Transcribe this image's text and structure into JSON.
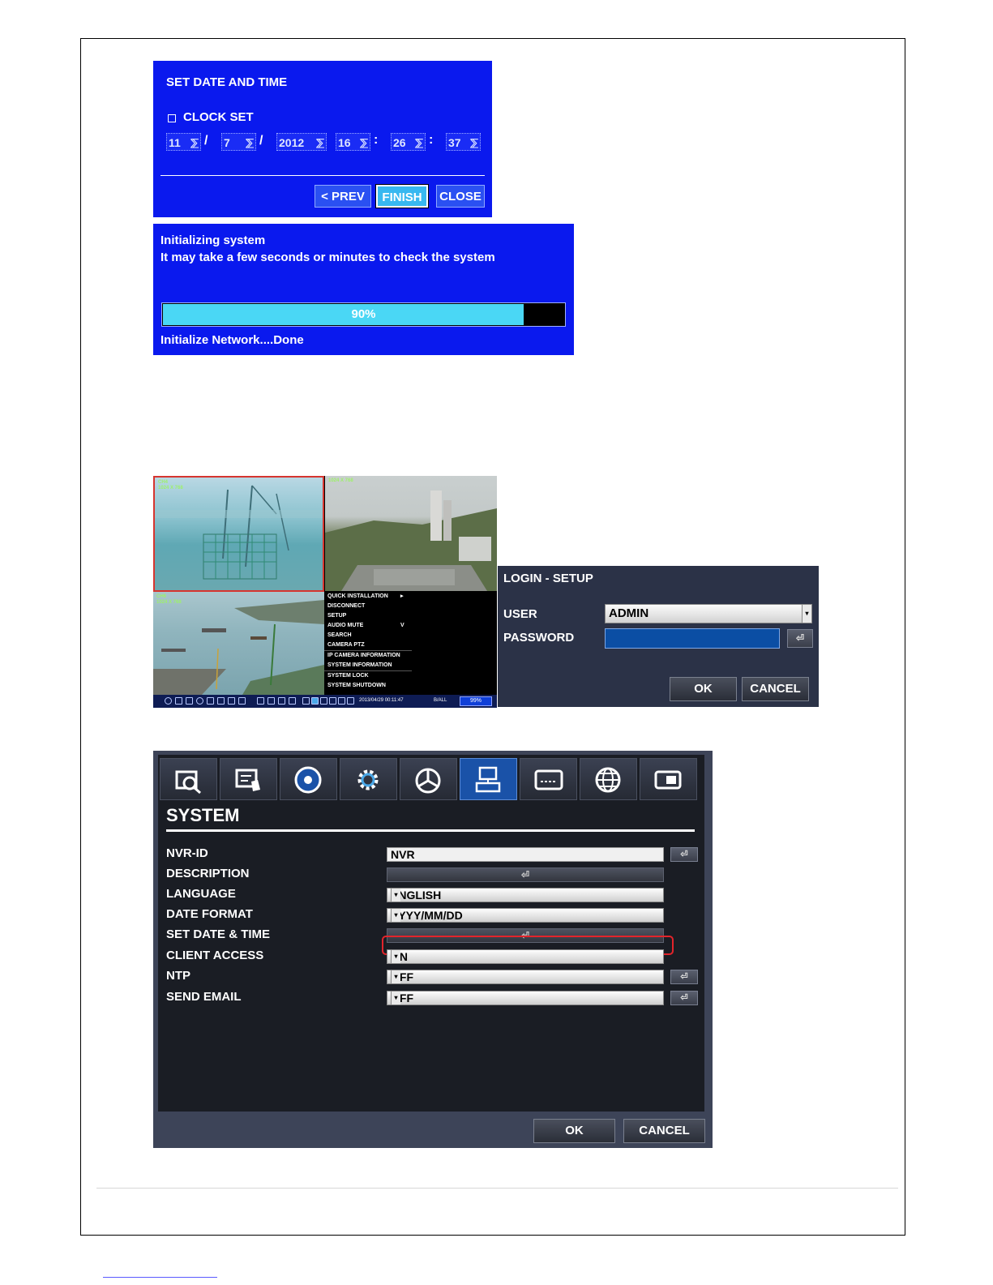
{
  "set_date_time": {
    "title": "SET DATE AND TIME",
    "clock_set_label": "CLOCK SET",
    "month": "11",
    "day": "7",
    "year": "2012",
    "hour": "16",
    "minute": "26",
    "second": "37",
    "date_sep": "/",
    "time_sep": ":",
    "spin_glyph": "⅀",
    "prev_label": "< PREV",
    "finish_label": "FINISH",
    "close_label": "CLOSE"
  },
  "init_system": {
    "line1": "Initializing system",
    "line2": "It may take a few seconds or minutes to check the system",
    "progress": 90,
    "progress_label": "90%",
    "status": "Initialize Network....Done"
  },
  "live_view": {
    "cam1_name": "CH4",
    "cam1_res": "1024 X 768",
    "cam2_res": "1024 X 768",
    "cam3_name": "CH6",
    "cam3_res": "1024 X 768",
    "menu": [
      "QUICK INSTALLATION",
      "DISCONNECT",
      "SETUP",
      "AUDIO MUTE",
      "SEARCH",
      "CAMERA PTZ",
      "IP CAMERA INFORMATION",
      "SYSTEM INFORMATION",
      "SYSTEM LOCK",
      "SYSTEM SHUTDOWN"
    ],
    "menu_arrow_1": "▸",
    "menu_arrow_4": "V",
    "timestamp": "2013/04/29 00:11:47",
    "mode": "B/ALL",
    "hdd": "99%"
  },
  "login_setup": {
    "title": "LOGIN  -  SETUP",
    "user_label": "USER",
    "user_value": "ADMIN",
    "password_label": "PASSWORD",
    "ok_label": "OK",
    "cancel_label": "CANCEL"
  },
  "system": {
    "tabs": [
      "search-icon",
      "event-icon",
      "record-icon",
      "setup-gear-icon",
      "chart-icon",
      "system-icon",
      "display-icon",
      "network-icon",
      "device-icon"
    ],
    "active_tab": 5,
    "title": "SYSTEM",
    "nvr_id_label": "NVR-ID",
    "nvr_id_value": "NVR",
    "description_label": "DESCRIPTION",
    "language_label": "LANGUAGE",
    "language_value": "ENGLISH",
    "date_format_label": "DATE FORMAT",
    "date_format_value": "YYYY/MM/DD",
    "set_date_time_label": "SET DATE & TIME",
    "client_access_label": "CLIENT ACCESS",
    "client_access_value": "ON",
    "ntp_label": "NTP",
    "ntp_value": "OFF",
    "send_email_label": "SEND EMAIL",
    "send_email_value": "OFF",
    "enter_glyph": "⏎",
    "ok_label": "OK",
    "cancel_label": "CANCEL"
  },
  "colors": {
    "dialog_blue": "#0a19ee",
    "progress_fill": "#4ad7f5",
    "highlight_red": "#e3242b",
    "system_bg": "#1a1d24"
  }
}
